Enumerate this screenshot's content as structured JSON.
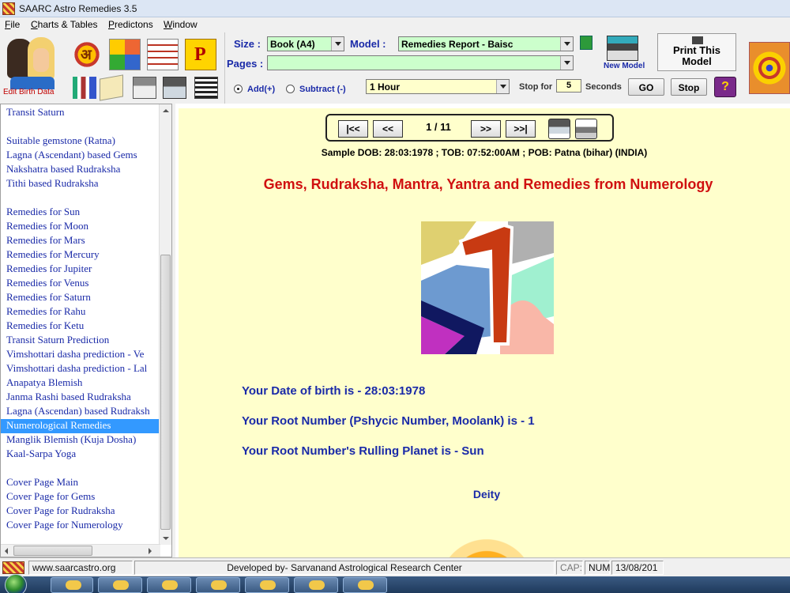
{
  "window": {
    "title": "SAARC Astro Remedies 3.5"
  },
  "menu": [
    "File",
    "Charts & Tables",
    "Predictons",
    "Window"
  ],
  "left_toolbar": {
    "edit_birth_label": "Edit Birth Data",
    "p_icon_letter": "P",
    "om_glyph": "अ"
  },
  "toolbar": {
    "size_label": "Size :",
    "size_value": "Book (A4)",
    "model_label": "Model :",
    "model_value": "Remedies Report - Baisc",
    "pages_label": "Pages :",
    "pages_value": "",
    "new_model_label": "New Model",
    "print_model_label_1": "Print This",
    "print_model_label_2": "Model",
    "add_label": "Add(+)",
    "subtract_label": "Subtract (-)",
    "interval_value": "1 Hour",
    "stop_for_label": "Stop for",
    "stop_seconds_value": "5",
    "seconds_label": "Seconds",
    "go_label": "GO",
    "stop_label": "Stop",
    "help_glyph": "?"
  },
  "sidebar_items": [
    "Transit Saturn",
    "",
    "Suitable gemstone (Ratna)",
    "Lagna (Ascendant) based Gems",
    "Nakshatra based Rudraksha",
    "Tithi based Rudraksha",
    "",
    "Remedies for Sun",
    "Remedies for Moon",
    "Remedies for Mars",
    "Remedies for Mercury",
    "Remedies for Jupiter",
    "Remedies for Venus",
    "Remedies for Saturn",
    "Remedies for Rahu",
    "Remedies for Ketu",
    "Transit Saturn Prediction",
    "Vimshottari dasha prediction - Ve",
    "Vimshottari dasha prediction - Lal",
    "Anapatya Blemish",
    "Janma Rashi based Rudraksha",
    "Lagna (Ascendan) based Rudraksh",
    "Numerological Remedies",
    "Manglik Blemish (Kuja Dosha)",
    "Kaal-Sarpa Yoga",
    "",
    "Cover Page Main",
    "Cover Page for Gems",
    "Cover Page for Rudraksha",
    "Cover Page for Numerology"
  ],
  "sidebar_selected": "Numerological Remedies",
  "pager": {
    "first": "|<<",
    "prev": "<<",
    "page_text": "1 / 11",
    "next": ">>",
    "last": ">>|"
  },
  "report": {
    "sample_line": "Sample  DOB: 28:03:1978 ; TOB: 07:52:00AM ; POB: Patna (bihar) (INDIA)",
    "heading": "Gems, Rudraksha, Mantra, Yantra and Remedies from Numerology",
    "dob_line": "Your Date of birth is - 28:03:1978",
    "root_line": "Your Root Number (Pshycic Number, Moolank) is - 1",
    "planet_line": "Your Root Number's Rulling Planet is - Sun",
    "deity_label": "Deity"
  },
  "status": {
    "website": "www.saarcastro.org",
    "developer": "Developed by- Sarvanand Astrological Research Center",
    "caps": "CAP:",
    "num": "NUM",
    "date": "13/08/201"
  }
}
